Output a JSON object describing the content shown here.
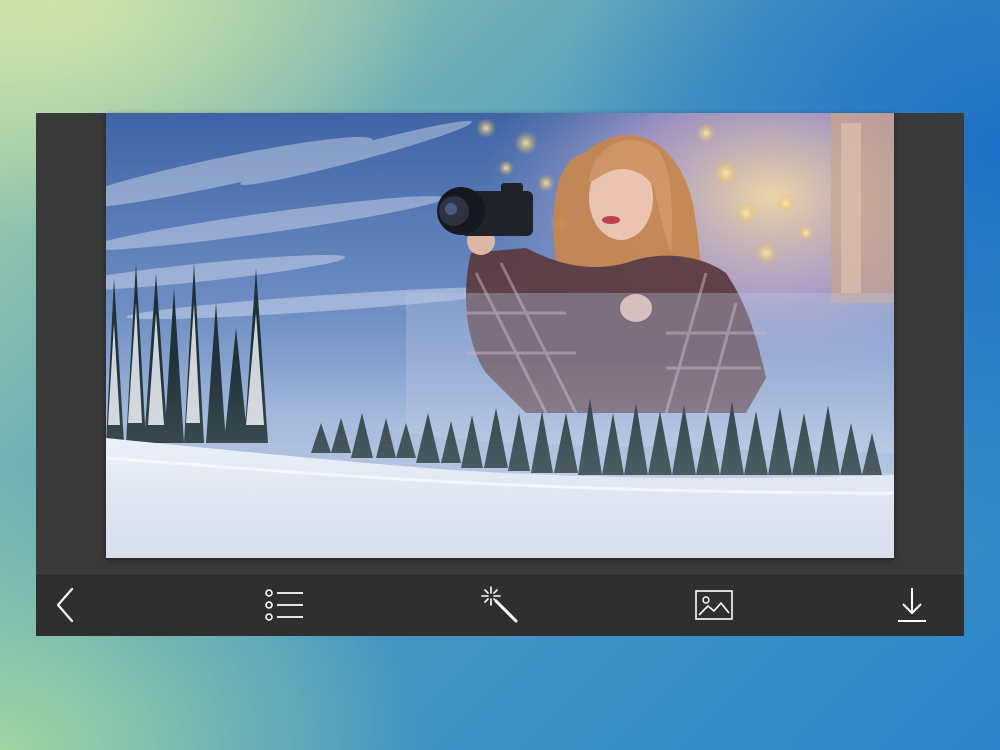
{
  "toolbar": {
    "items": [
      {
        "icon": "chevron-left-icon"
      },
      {
        "icon": "list-icon"
      },
      {
        "icon": "magic-wand-icon"
      },
      {
        "icon": "image-icon"
      },
      {
        "icon": "download-icon"
      }
    ]
  },
  "colors": {
    "frame": "#3a3a3a",
    "toolbar": "#2f2f2f",
    "icon": "#ffffff"
  }
}
